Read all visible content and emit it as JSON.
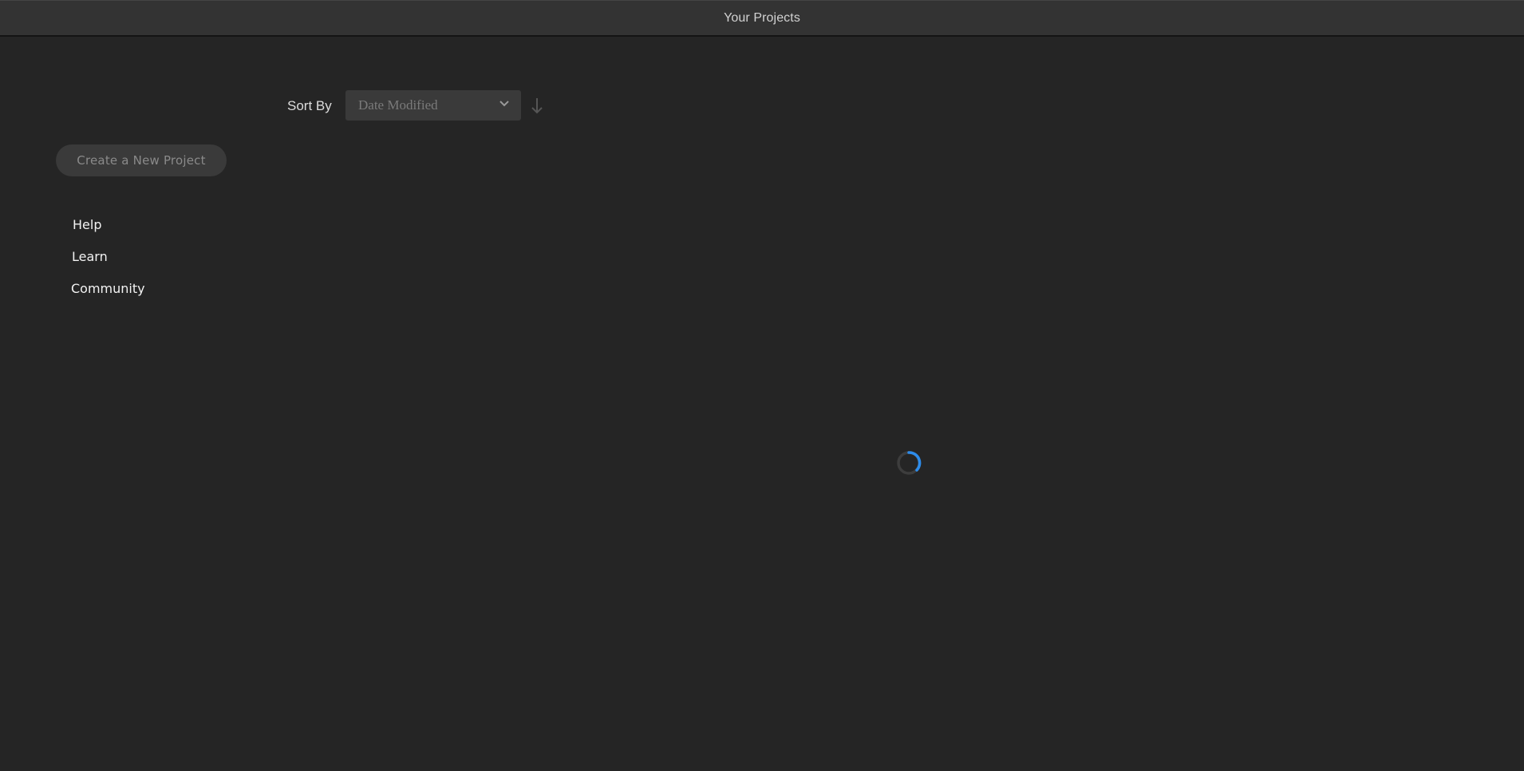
{
  "window": {
    "title": "Your Projects"
  },
  "sort": {
    "label": "Sort By",
    "selected": "Date Modified",
    "direction_icon": "arrow-down-icon"
  },
  "sidebar": {
    "create_button": "Create a New Project",
    "links": [
      {
        "label": "Help"
      },
      {
        "label": "Learn"
      },
      {
        "label": "Community"
      }
    ]
  },
  "status": {
    "icon": "loading-spinner-icon"
  },
  "colors": {
    "background": "#252525",
    "titlebar": "#333333",
    "accent": "#2d8ceb"
  }
}
